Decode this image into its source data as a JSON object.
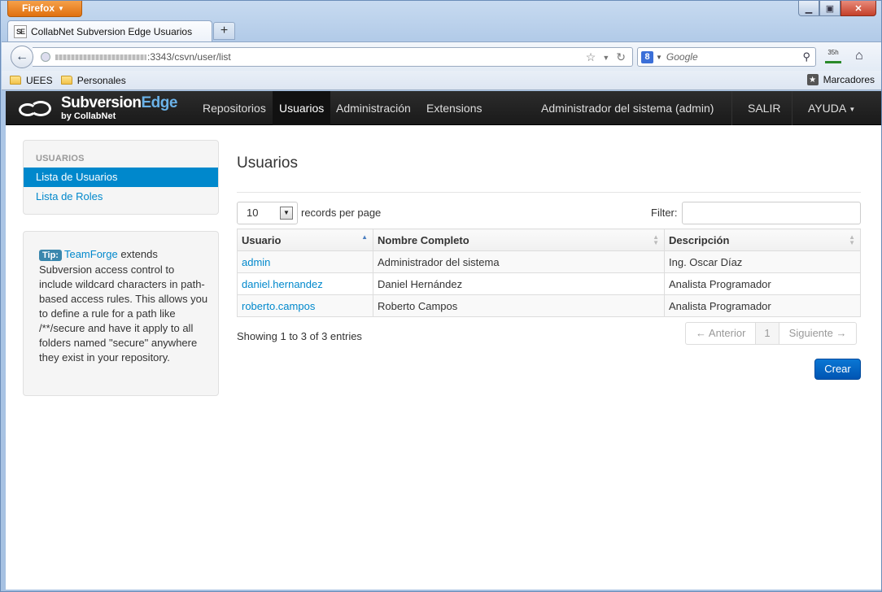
{
  "browser": {
    "app_button": "Firefox",
    "tab_title": "CollabNet Subversion Edge Usuarios",
    "favicon_text": "SE",
    "new_tab": "+",
    "url": ":3343/csvn/user/list",
    "search_placeholder": "Google",
    "search_engine_letter": "8",
    "status_badge": "35h",
    "bookmarks": [
      "UEES",
      "Personales"
    ],
    "bookmarks_menu": "Marcadores"
  },
  "app": {
    "brand_main": "Subversion",
    "brand_accent": "Edge",
    "brand_sub": "by CollabNet",
    "nav": [
      "Repositorios",
      "Usuarios",
      "Administración",
      "Extensions"
    ],
    "user": "Administrador del sistema (admin)",
    "logout": "SALIR",
    "help": "AYUDA"
  },
  "sidebar": {
    "header": "USUARIOS",
    "items": [
      "Lista de Usuarios",
      "Lista de Roles"
    ],
    "tip_label": "Tip:",
    "tip_link": "TeamForge",
    "tip_text": " extends Subversion access control to include wildcard characters in path-based access rules. This allows you to define a rule for a path like /**/secure and have it apply to all folders named \"secure\" anywhere they exist in your repository."
  },
  "main": {
    "title": "Usuarios",
    "page_length": "10",
    "page_length_label": "records per page",
    "filter_label": "Filter:",
    "columns": [
      "Usuario",
      "Nombre Completo",
      "Descripción"
    ],
    "rows": [
      [
        "admin",
        "Administrador del sistema",
        "Ing. Oscar Díaz"
      ],
      [
        "daniel.hernandez",
        "Daniel Hernández",
        "Analista Programador"
      ],
      [
        "roberto.campos",
        "Roberto Campos",
        "Analista Programador"
      ]
    ],
    "info": "Showing 1 to 3 of 3 entries",
    "prev": "← Anterior",
    "page": "1",
    "next": "Siguiente →",
    "create": "Crear"
  },
  "colors": {
    "link": "#0088cc",
    "primary": "#0a6fd0",
    "navbar": "#1b1b1b"
  }
}
